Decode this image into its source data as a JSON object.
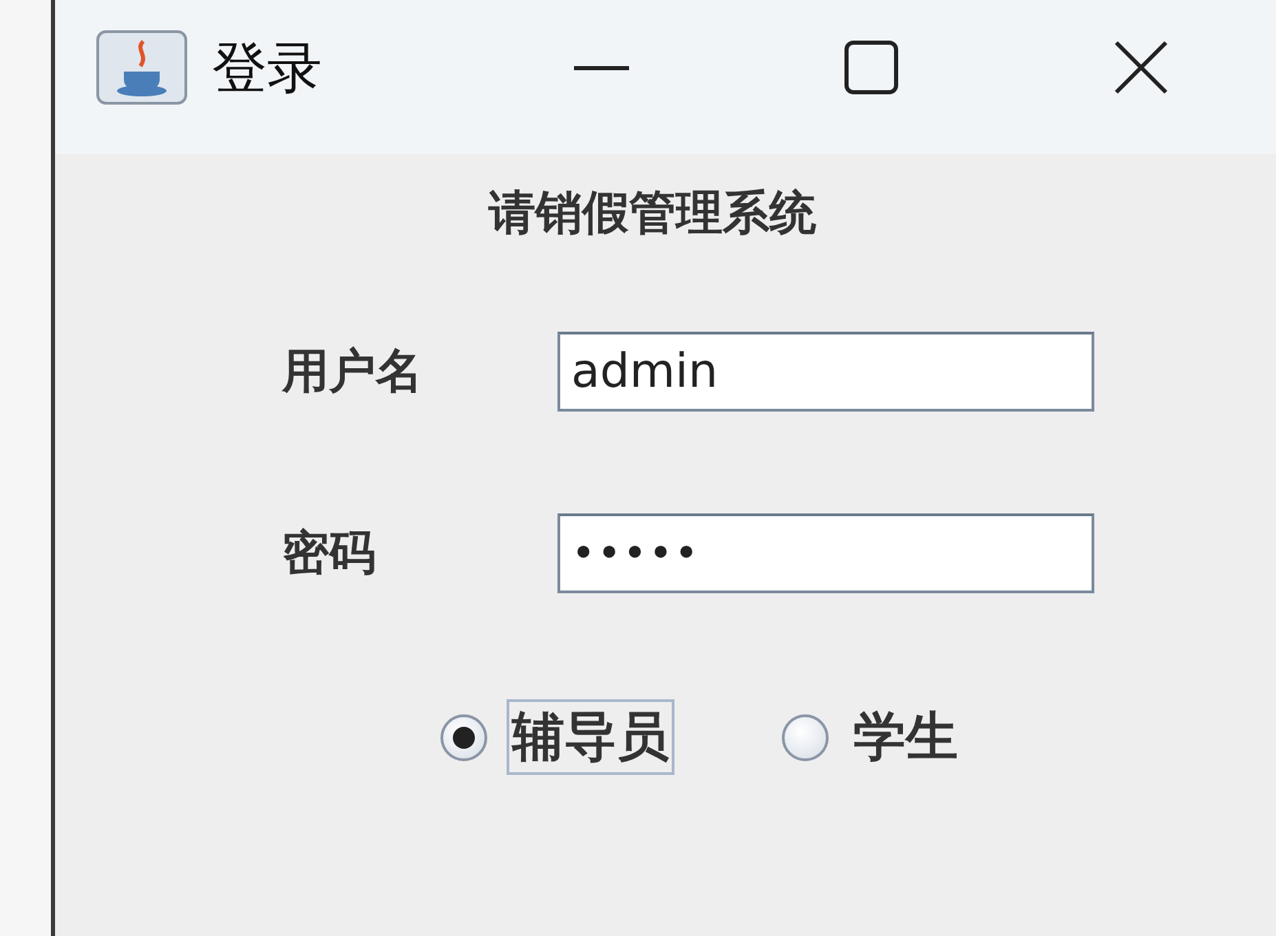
{
  "window": {
    "title": "登录"
  },
  "heading": "请销假管理系统",
  "fields": [
    {
      "label": "用户名",
      "kind": "text",
      "value": "admin"
    },
    {
      "label": "密码",
      "kind": "password",
      "value": "•••••"
    }
  ],
  "roles": [
    {
      "label": "辅导员",
      "selected": true,
      "focused": true
    },
    {
      "label": "学生",
      "selected": false,
      "focused": false
    }
  ]
}
